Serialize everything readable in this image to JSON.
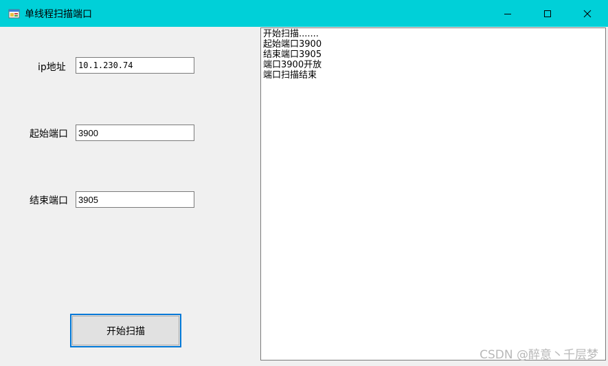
{
  "window": {
    "title": "单线程扫描端口",
    "icon": "winforms-app-icon",
    "controls": [
      "minimize-icon",
      "maximize-icon",
      "close-icon"
    ]
  },
  "form": {
    "ip_label": "ip地址",
    "ip_value": "10.1.230.74",
    "start_port_label": "起始端口",
    "start_port_value": "3900",
    "end_port_label": "结束端口",
    "end_port_value": "3905",
    "scan_button_label": "开始扫描"
  },
  "log": {
    "lines": [
      "开始扫描.......",
      "起始端口3900",
      "结束端口3905",
      "端口3900开放",
      "端口扫描结束"
    ]
  },
  "watermark": "CSDN @醉意丶千层梦",
  "colors": {
    "titlebar": "#00d0d8",
    "window_bg": "#f0f0f0",
    "button_focus_border": "#0078d7"
  }
}
